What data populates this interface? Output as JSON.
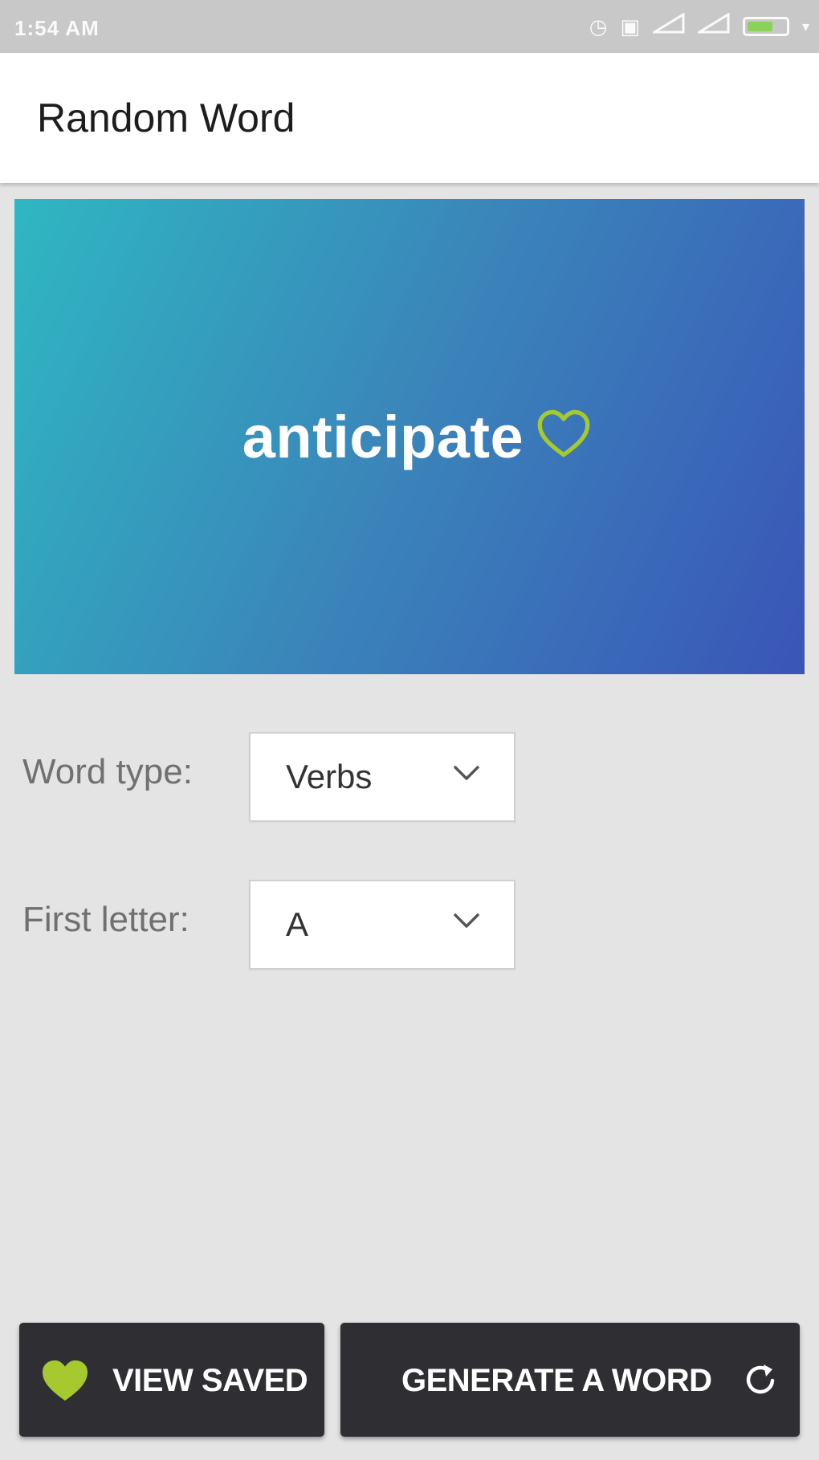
{
  "status_bar": {
    "time": "1:54 AM"
  },
  "app_bar": {
    "title": "Random Word"
  },
  "word_card": {
    "word": "anticipate",
    "heart_icon": "heart-outline-icon",
    "gradient_colors": [
      "#2fb7c2",
      "#3a86ba",
      "#3a55b8"
    ],
    "heart_color": "#a6c930"
  },
  "form": {
    "word_type": {
      "label": "Word type:",
      "value": "Verbs"
    },
    "first_letter": {
      "label": "First letter:",
      "value": "A"
    }
  },
  "buttons": {
    "view_saved": {
      "label": "VIEW SAVED",
      "icon": "heart-filled-icon",
      "icon_color": "#a6c930"
    },
    "generate": {
      "label": "GENERATE A WORD",
      "icon": "refresh-icon"
    },
    "background": "#2e2e33"
  }
}
